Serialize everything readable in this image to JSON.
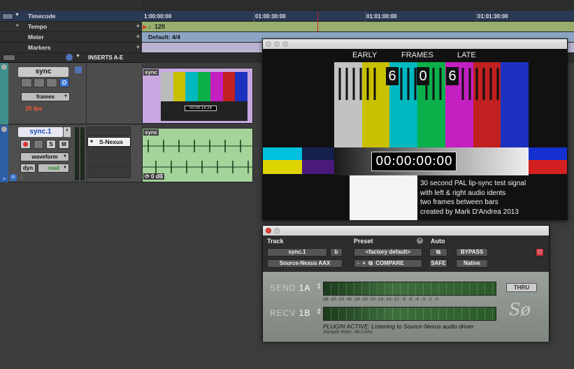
{
  "rulers": {
    "timecode_label": "Timecode",
    "tempo_label": "Tempo",
    "meter_label": "Meter",
    "markers_label": "Markers"
  },
  "timeline": {
    "times": [
      "1:00:00:00",
      "01:00:30:00",
      "01:01:00:00",
      "01:01:30:00"
    ],
    "tempo_value": "120",
    "meter_value": "Default: 4/4"
  },
  "edit_header": {
    "inserts_label": "INSERTS A-E"
  },
  "tracks": [
    {
      "name": "sync",
      "view": "frames",
      "rate": "25 fps",
      "clip_name": "sync",
      "clip_timecode": "00:00:14:24"
    },
    {
      "name": "sync.1",
      "solo": "S",
      "mute": "M",
      "view": "waveform",
      "auto_label": "dyn",
      "auto_mode": "read",
      "insert": "S-Nexus",
      "clip_name": "sync",
      "clip_gain": "0 dB"
    }
  ],
  "video": {
    "early": "EARLY",
    "frames": "FRAMES",
    "late": "LATE",
    "digits": [
      "6",
      "0",
      "6"
    ],
    "timecode": "00:00:00:00",
    "caption": [
      "30 second PAL lip-sync test signal",
      "with left & right audio idents",
      "two frames between bars",
      "created by Mark D'Andrea 2013"
    ]
  },
  "plugin": {
    "track_label": "Track",
    "preset_label": "Preset",
    "auto_label": "Auto",
    "track_name": "sync.1",
    "track_b": "b",
    "preset_name": "<factory default>",
    "plugin_name": "Source-Nexus AAX",
    "compare": "COMPARE",
    "safe": "SAFE",
    "bypass": "BYPASS",
    "native": "Native",
    "send_label": "SEND",
    "send_channel": "1A",
    "recv_label": "RECV",
    "recv_channel": "1B",
    "thru": "THRU",
    "scale": "dB -80 -50 -40 -34 -25 -20 -18 -14 -12  -9  -6  -4  -3  -2   0",
    "status": "PLUGIN ACTIVE: Listening to Source-Nexus audio driver",
    "sample_rate": "Sample Rate: 48.0 khz",
    "logo": "Sø"
  },
  "colors": {
    "record": "#e8433a",
    "sync_name_bg": "#c9c9c9",
    "sync1_name_bg": "#e8e8f4",
    "video_clip_bg": "#c8a8e0",
    "audio_clip_bg": "#a4d49a",
    "rate_text": "#ff5a3a"
  }
}
